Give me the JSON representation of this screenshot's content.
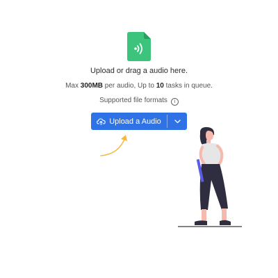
{
  "upload": {
    "title": "Upload or drag a audio here.",
    "limits_prefix": "Max ",
    "size": "300MB",
    "limits_middle": " per audio, Up to ",
    "tasks": "10",
    "limits_suffix": " tasks in queue.",
    "formats_label": "Supported file formats",
    "info_glyph": "i",
    "button_label": "Upload a Audio"
  },
  "colors": {
    "accent": "#2f72e5",
    "file_icon": "#3cc47c",
    "arrow": "#f5b83d"
  },
  "icons": {
    "file": "audio-file-icon",
    "upload": "cloud-upload-icon",
    "dropdown": "chevron-down-icon",
    "info": "info-icon"
  }
}
